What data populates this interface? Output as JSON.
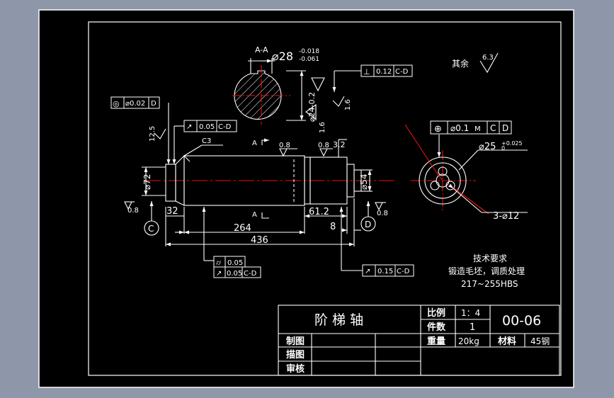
{
  "section_label": "A-A",
  "section_dia": "⌀28",
  "section_tol_upper": "-0.018",
  "section_tol_lower": "-0.061",
  "keyway_depth": "⌀24-0.2",
  "perp_symbol": "⊥",
  "perp_tol": "0.12",
  "perp_datum": "C-D",
  "conc_symbol": "◎",
  "conc_tol": "⌀0.02",
  "conc_datum": "D",
  "runout_symbol": "↗",
  "runout_tol": "0.05",
  "runout_datum": "C-D",
  "pos_symbol": "⊕",
  "pos_tol": "⌀0.1",
  "pos_modifier": "M",
  "pos_datum_c": "C",
  "pos_datum_d": "D",
  "remaining_label": "其余",
  "remaining_roughness": "6.3",
  "roughness_08": "0.8",
  "roughness_125": "12.5",
  "roughness_16": "1.6",
  "roughness_32": "3.2",
  "chamfer": "C3",
  "section_arrow_label": "A",
  "dia72": "⌀72",
  "dia54": "⌀54",
  "dia25": "⌀25",
  "dia25_tol": "+0.025",
  "dia25_tol_low": "0",
  "holes": "3-⌀12",
  "dim_32": "32",
  "dim_264": "264",
  "dim_436": "436",
  "dim_612": "61.2",
  "dim_8": "8",
  "datum_c": "C",
  "datum_d": "D",
  "cyl_symbol": "⌭",
  "cyl_tol": "0.05",
  "runout2_tol": "0.05",
  "runout2_datum": "C-D",
  "runout3_tol": "0.15",
  "runout3_datum": "C-D",
  "tech_title": "技术要求",
  "tech_line1": "锻造毛坯，调质处理",
  "tech_line2": "217~255HBS",
  "tb_part_name": "阶 梯 轴",
  "tb_scale_label": "比例",
  "tb_scale_value": "1：4",
  "tb_qty_label": "件数",
  "tb_qty_value": "1",
  "tb_weight_label": "重量",
  "tb_weight_value": "20kg",
  "tb_material_label": "材料",
  "tb_material_value": "45钢",
  "tb_drawing_no": "00-06",
  "tb_drawn_label": "制图",
  "tb_traced_label": "描图",
  "tb_checked_label": "审核"
}
